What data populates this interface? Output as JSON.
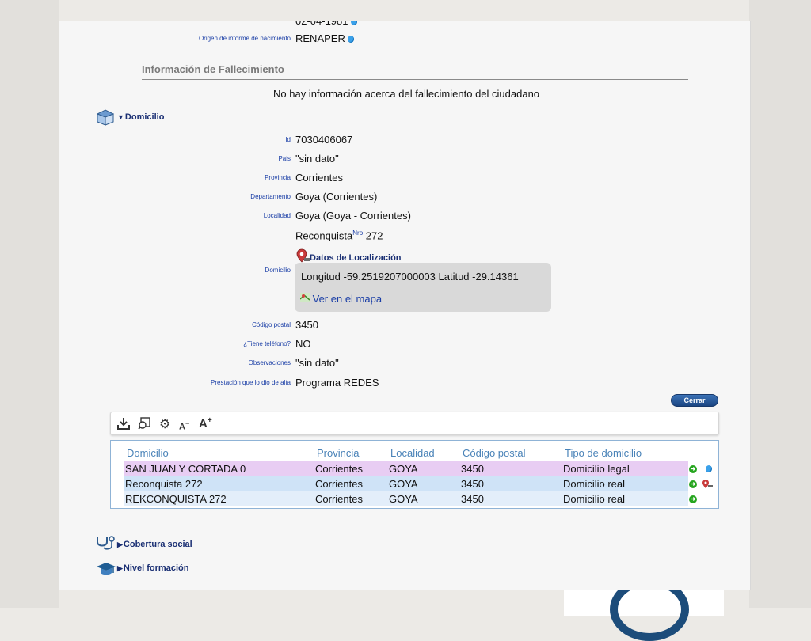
{
  "birth": {
    "top_partial_value": "02-04-1981",
    "origin_label": "Origen de informe de nacimiento",
    "origin_value": "RENAPER"
  },
  "death": {
    "heading": "Información de Fallecimiento",
    "message": "No hay información acerca del fallecimiento del ciudadano"
  },
  "domicilio": {
    "toggle_label": "Domicilio",
    "fields": {
      "id_label": "Id",
      "id_value": "7030406067",
      "pais_label": "Pais",
      "pais_value": "\"sin dato\"",
      "provincia_label": "Provincia",
      "provincia_value": "Corrientes",
      "departamento_label": "Departamento",
      "departamento_value": "Goya (Corrientes)",
      "localidad_label": "Localidad",
      "localidad_value": "Goya (Goya - Corrientes)",
      "street": "Reconquista",
      "nro_sup": "Nro",
      "street_number": "272",
      "loc_link": "Datos de Localización",
      "domicilio_label": "Domicilio",
      "coords": "Longitud -59.2519207000003  Latitud -29.14361",
      "map_link": "Ver en el mapa",
      "cp_label": "Código postal",
      "cp_value": "3450",
      "tel_label": "¿Tiene teléfono?",
      "tel_value": "NO",
      "obs_label": "Observaciones",
      "obs_value": "\"sin dato\"",
      "prest_label": "Prestación que lo dio de alta",
      "prest_value": "Programa REDES"
    },
    "close_button": "Cerrar"
  },
  "toolbar": {
    "icons": [
      "download-icon",
      "search-window-icon",
      "gear-icon",
      "font-decrease-icon",
      "font-increase-icon"
    ],
    "font_decrease": "A",
    "font_decrease_sup": "−",
    "font_increase": "A",
    "font_increase_sup": "+"
  },
  "table": {
    "columns": [
      "Domicilio",
      "Provincia",
      "Localidad",
      "Código postal",
      "Tipo de domicilio"
    ],
    "rows": [
      {
        "domicilio": "SAN JUAN Y CORTADA 0",
        "provincia": "Corrientes",
        "localidad": "GOYA",
        "cp": "3450",
        "tipo": "Domicilio legal",
        "color": "#e8cdf3"
      },
      {
        "domicilio": "Reconquista 272",
        "provincia": "Corrientes",
        "localidad": "GOYA",
        "cp": "3450",
        "tipo": "Domicilio real",
        "color": "#cfe3f7"
      },
      {
        "domicilio": "REKCONQUISTA 272",
        "provincia": "Corrientes",
        "localidad": "GOYA",
        "cp": "3450",
        "tipo": "Domicilio real",
        "color": "#e3eefa"
      }
    ]
  },
  "sections": {
    "cobertura": "Cobertura social",
    "nivel": "Nivel formación"
  },
  "colors": {
    "label_blue": "#1a3ea6",
    "toggle_navy": "#1a2f73",
    "header_blue": "#4a83b8",
    "legal_row": "#e8cdf3",
    "real_row": "#cfe3f7",
    "go_green": "#26a51f"
  }
}
